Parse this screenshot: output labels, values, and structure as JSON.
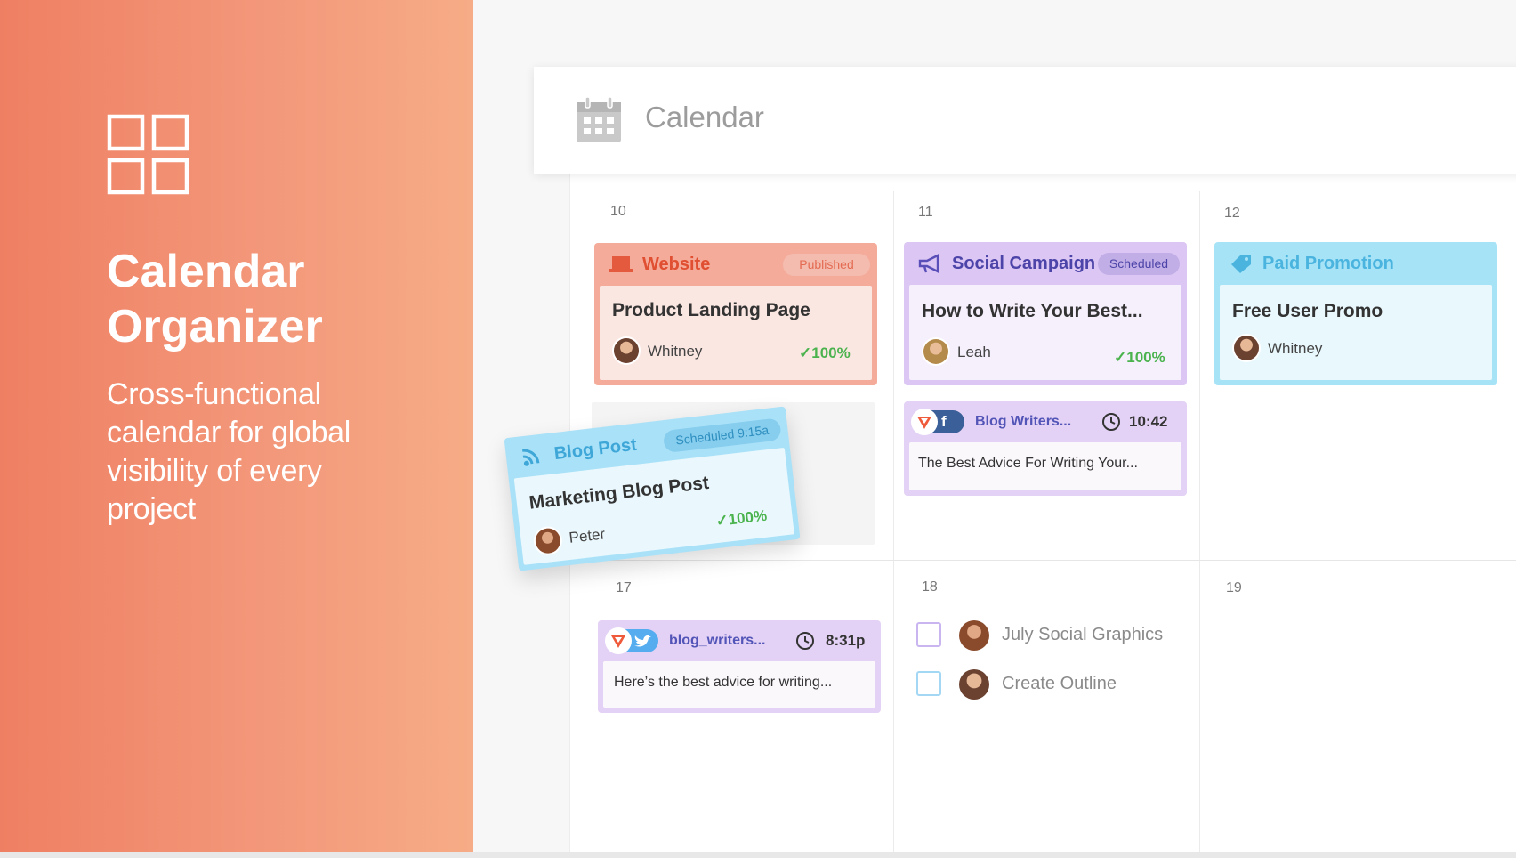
{
  "hero": {
    "title": "Calendar Organizer",
    "subtitle": "Cross-functional calendar for global visibility of every project",
    "icon": "grid-four-squares-icon",
    "background_colors": [
      "#ef7f62",
      "#f6ac86"
    ]
  },
  "calendar": {
    "title": "Calendar",
    "icon": "calendar-icon",
    "days": {
      "d10": "10",
      "d11": "11",
      "d12": "12",
      "d17": "17",
      "d18": "18",
      "d19": "19"
    }
  },
  "cards": {
    "website": {
      "category": "Website",
      "status": "Published",
      "title": "Product Landing Page",
      "person": "Whitney",
      "percent": "100%",
      "icon": "laptop-icon",
      "accent": "#e35a3e"
    },
    "social_campaign": {
      "category": "Social Campaign",
      "status": "Scheduled",
      "title": "How to Write Your Best...",
      "person": "Leah",
      "percent": "100%",
      "icon": "megaphone-icon",
      "accent": "#5a4fb8"
    },
    "paid_promotion": {
      "category": "Paid Promotion",
      "title": "Free User Promo",
      "person": "Whitney",
      "icon": "tag-icon",
      "accent": "#4ab4df"
    },
    "blog_post": {
      "category": "Blog Post",
      "status": "Scheduled 9:15a",
      "title": "Marketing Blog Post",
      "person": "Peter",
      "percent": "100%",
      "icon": "rss-icon",
      "accent": "#3fa7d8"
    }
  },
  "posts": {
    "facebook": {
      "handle": "Blog Writers...",
      "time": "10:42",
      "text": "The Best Advice For Writing Your...",
      "network": "facebook-icon"
    },
    "twitter": {
      "handle": "blog_writers...",
      "time": "8:31p",
      "text": "Here’s the best advice for writing...",
      "network": "twitter-icon"
    }
  },
  "tasks": [
    {
      "label": "July Social Graphics"
    },
    {
      "label": "Create Outline"
    }
  ]
}
